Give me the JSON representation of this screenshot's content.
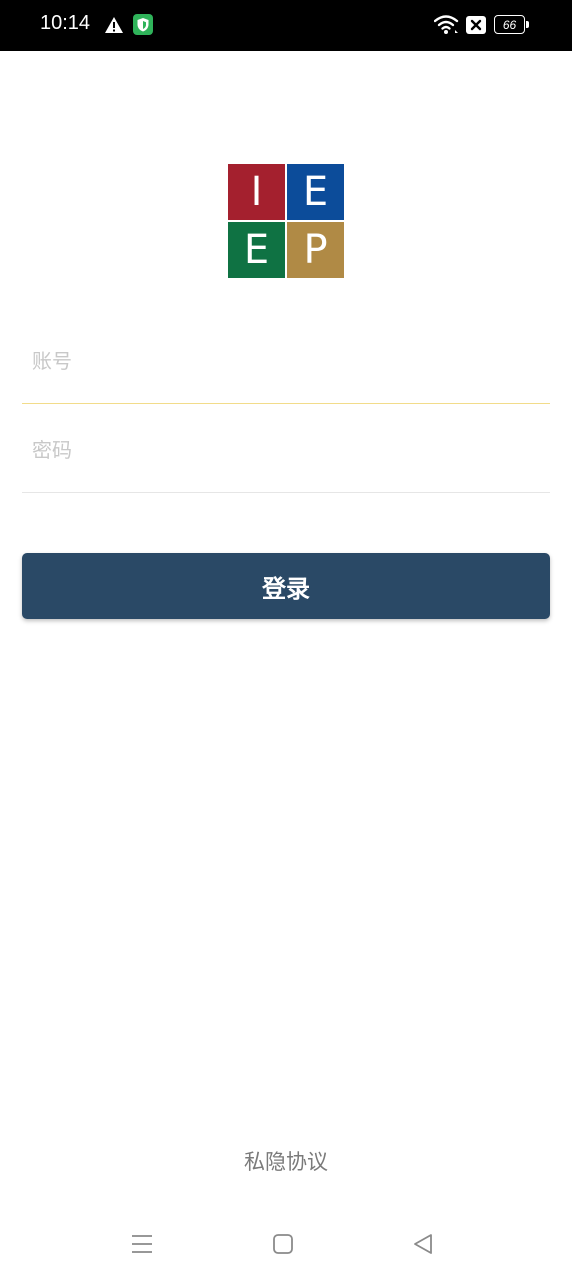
{
  "status_bar": {
    "time": "10:14",
    "battery": "66",
    "icons": [
      "warning-icon",
      "shield-icon",
      "wifi-icon",
      "no-sim-icon",
      "battery-icon"
    ],
    "shield_color": "#2fb35a"
  },
  "logo": {
    "letters": [
      "I",
      "E",
      "E",
      "P"
    ],
    "colors": [
      "#a4202e",
      "#0c4c9a",
      "#0f7243",
      "#b08a45"
    ]
  },
  "form": {
    "account_placeholder": "账号",
    "account_value": "",
    "password_placeholder": "密码",
    "password_value": "",
    "login_label": "登录",
    "button_color": "#2a4966",
    "focus_underline_color": "#f2dc8a"
  },
  "footer": {
    "privacy_label": "私隐协议"
  },
  "nav_bar": {
    "icons": [
      "menu-icon",
      "home-icon",
      "back-icon"
    ]
  }
}
